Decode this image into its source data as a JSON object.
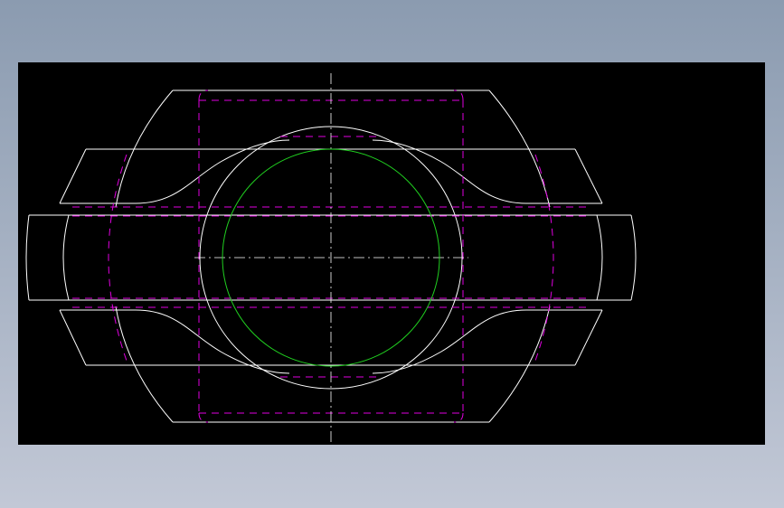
{
  "window": {
    "title": ""
  },
  "colors": {
    "background_top": "#8b9bb0",
    "background_bottom": "#c2c8d6",
    "viewport": "#000000",
    "outline": "#ffffff",
    "hidden_line": "#e000e0",
    "center_line": "#ffffff",
    "circle": "#20d020"
  }
}
